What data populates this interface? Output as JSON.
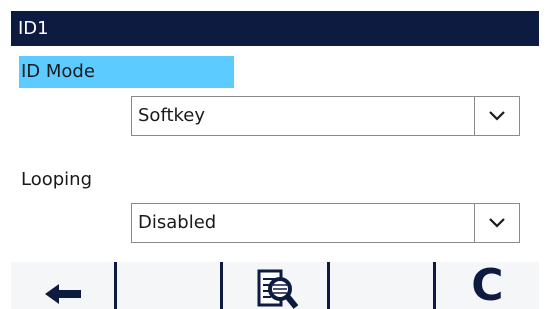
{
  "header": {
    "title": "ID1"
  },
  "fields": [
    {
      "label": "ID Mode",
      "value": "Softkey",
      "selected": true
    },
    {
      "label": "Looping",
      "value": "Disabled",
      "selected": false
    }
  ],
  "softkeys": [
    {
      "icon": "left-arrow-icon"
    },
    {
      "icon": ""
    },
    {
      "icon": "magnify-report-icon"
    },
    {
      "icon": ""
    },
    {
      "icon": "clear-c-icon",
      "label": "C"
    }
  ],
  "colors": {
    "header_bg": "#0c1b3f",
    "selection": "#5ccbff",
    "softkey_bg": "#f5f6f8"
  }
}
